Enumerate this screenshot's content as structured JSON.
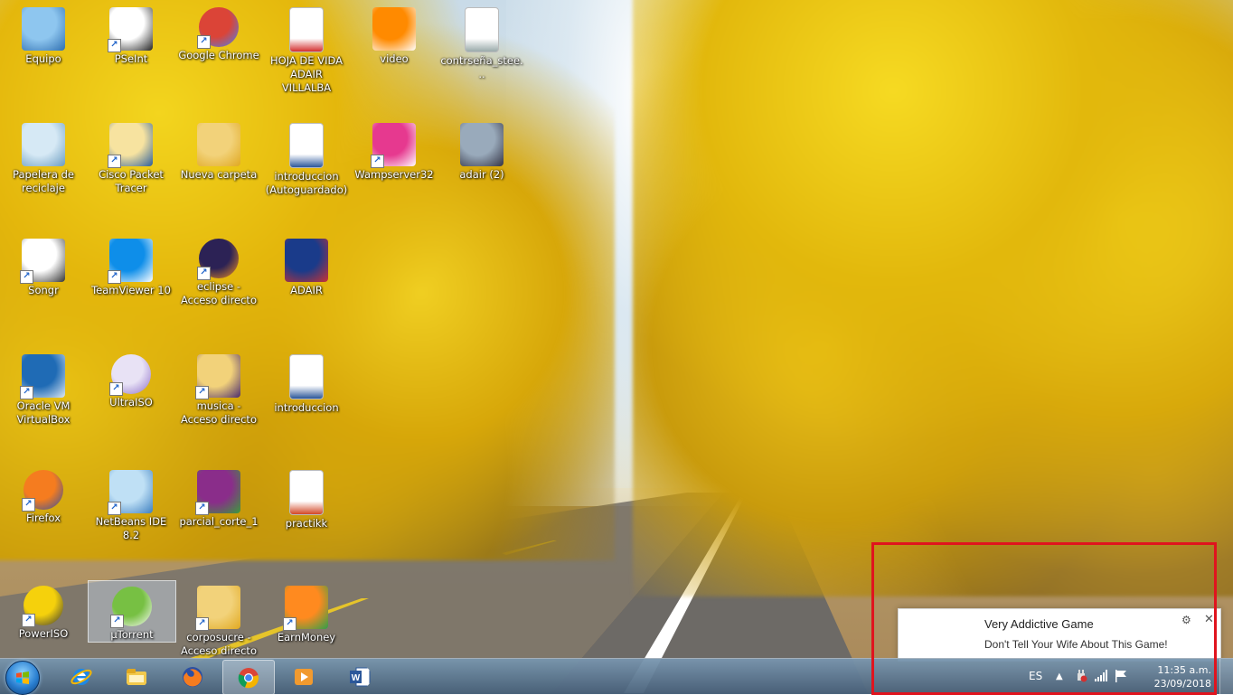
{
  "desktop": {
    "icons": [
      {
        "label": "Equipo",
        "icon": "computer-icon"
      },
      {
        "label": "PSeInt",
        "icon": "pseint-icon"
      },
      {
        "label": "Google Chrome",
        "icon": "chrome-icon"
      },
      {
        "label": "HOJA DE VIDA ADAIR VILLALBA",
        "icon": "pdf-document-icon"
      },
      {
        "label": "video",
        "icon": "vlc-cone-icon"
      },
      {
        "label": "contrseña_stee...",
        "icon": "text-file-icon"
      },
      {
        "label": "Papelera de reciclaje",
        "icon": "recycle-bin-icon"
      },
      {
        "label": "Cisco Packet Tracer",
        "icon": "cisco-packet-tracer-icon"
      },
      {
        "label": "Nueva carpeta",
        "icon": "folder-icon"
      },
      {
        "label": "introduccion (Autoguardado)",
        "icon": "word-document-icon"
      },
      {
        "label": "Wampserver32",
        "icon": "wampserver-icon"
      },
      {
        "label": "adair (2)",
        "icon": "photo-icon"
      },
      {
        "label": "Songr",
        "icon": "music-note-icon"
      },
      {
        "label": "TeamViewer 10",
        "icon": "teamviewer-icon"
      },
      {
        "label": "eclipse - Acceso directo",
        "icon": "eclipse-icon"
      },
      {
        "label": "ADAIR",
        "icon": "portrait-photo-icon"
      },
      {
        "label": "Oracle VM VirtualBox",
        "icon": "virtualbox-icon"
      },
      {
        "label": "UltraISO",
        "icon": "disc-icon"
      },
      {
        "label": "musica - Acceso directo",
        "icon": "music-folder-icon"
      },
      {
        "label": "introduccion",
        "icon": "word-document-icon"
      },
      {
        "label": "Firefox",
        "icon": "firefox-icon"
      },
      {
        "label": "NetBeans IDE 8.2",
        "icon": "netbeans-icon"
      },
      {
        "label": "parcial_corte_1",
        "icon": "winrar-archive-icon"
      },
      {
        "label": "practikk",
        "icon": "powerpoint-document-icon"
      },
      {
        "label": "PowerISO",
        "icon": "poweriso-icon"
      },
      {
        "label": "µTorrent",
        "icon": "utorrent-icon"
      },
      {
        "label": "corposucre - Acceso directo",
        "icon": "folder-icon"
      },
      {
        "label": "EarnMoney",
        "icon": "earnmoney-icon"
      }
    ]
  },
  "taskbar": {
    "start_icon": "windows-start-icon",
    "pinned": [
      {
        "name": "internet-explorer",
        "icon": "internet-explorer-icon"
      },
      {
        "name": "file-explorer",
        "icon": "file-explorer-icon"
      },
      {
        "name": "firefox",
        "icon": "firefox-icon"
      },
      {
        "name": "chrome",
        "icon": "chrome-icon"
      },
      {
        "name": "media-player",
        "icon": "media-player-icon"
      },
      {
        "name": "word",
        "icon": "word-icon"
      }
    ],
    "tray": {
      "language": "ES",
      "time": "11:35 a.m.",
      "date": "23/09/2018"
    }
  },
  "notification": {
    "title": "Very Addictive Game",
    "body": "Don't Tell Your Wife About This Game!",
    "gear_glyph": "⚙",
    "close_glyph": "✕"
  },
  "colors": {
    "highlight": "#e0141e",
    "taskbar": "#5a7a98"
  }
}
